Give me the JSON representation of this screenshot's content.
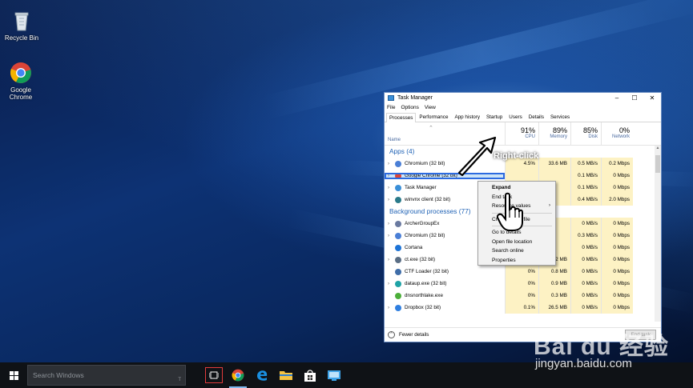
{
  "desktop": {
    "icons": [
      {
        "label": "Recycle Bin",
        "icon": "recycle-bin-icon"
      },
      {
        "label": "Google Chrome",
        "icon": "chrome-icon"
      }
    ]
  },
  "task_manager": {
    "title": "Task Manager",
    "window_controls": [
      "–",
      "☐",
      "✕"
    ],
    "menu": [
      "File",
      "Options",
      "View"
    ],
    "tabs": [
      "Processes",
      "Performance",
      "App history",
      "Startup",
      "Users",
      "Details",
      "Services"
    ],
    "active_tab": "Processes",
    "header": {
      "name": "Name",
      "cpu": {
        "pct": "91%",
        "label": "CPU"
      },
      "memory": {
        "pct": "89%",
        "label": "Memory"
      },
      "disk": {
        "pct": "85%",
        "label": "Disk"
      },
      "network": {
        "pct": "0%",
        "label": "Network"
      }
    },
    "groups": {
      "apps": "Apps (4)",
      "background": "Background processes (77)"
    },
    "apps": [
      {
        "name": "Chromium (32 bit)",
        "cpu": "4.5%",
        "mem": "33.6 MB",
        "disk": "0.5 MB/s",
        "net": "0.2 Mbps",
        "icon": "chromium-icon"
      },
      {
        "name": "Google Chrome (32 bit)",
        "cpu": "",
        "mem": "",
        "disk": "0.1 MB/s",
        "net": "0 Mbps",
        "icon": "chrome-icon"
      },
      {
        "name": "Task Manager",
        "cpu": "",
        "mem": "",
        "disk": "0.1 MB/s",
        "net": "0 Mbps",
        "icon": "task-manager-icon"
      },
      {
        "name": "winvnx client (32 bit)",
        "cpu": "",
        "mem": "",
        "disk": "0.4 MB/s",
        "net": "2.0 Mbps",
        "icon": "window-icon"
      }
    ],
    "background": [
      {
        "name": "ArcherGroupEx",
        "cpu": "",
        "mem": "",
        "disk": "0 MB/s",
        "net": "0 Mbps",
        "icon": "gear-icon"
      },
      {
        "name": "Chromium (32 bit)",
        "cpu": "",
        "mem": "",
        "disk": "0.3 MB/s",
        "net": "0 Mbps",
        "icon": "chromium-icon"
      },
      {
        "name": "Cortana",
        "cpu": "",
        "mem": "",
        "disk": "0 MB/s",
        "net": "0 Mbps",
        "icon": "cortana-icon"
      },
      {
        "name": "ct.exe (32 bit)",
        "cpu": "0%",
        "mem": "1.2 MB",
        "disk": "0 MB/s",
        "net": "0 Mbps",
        "icon": "exe-icon"
      },
      {
        "name": "CTF Loader (32 bit)",
        "cpu": "0%",
        "mem": "0.8 MB",
        "disk": "0 MB/s",
        "net": "0 Mbps",
        "icon": "ctf-icon"
      },
      {
        "name": "dataup.exe (32 bit)",
        "cpu": "0%",
        "mem": "0.9 MB",
        "disk": "0 MB/s",
        "net": "0 Mbps",
        "icon": "dataup-icon"
      },
      {
        "name": "dnsnorthlake.exe",
        "cpu": "0%",
        "mem": "0.3 MB",
        "disk": "0 MB/s",
        "net": "0 Mbps",
        "icon": "leaf-icon"
      },
      {
        "name": "Dropbox (32 bit)",
        "cpu": "0.1%",
        "mem": "26.5 MB",
        "disk": "0 MB/s",
        "net": "0 Mbps",
        "icon": "dropbox-icon"
      }
    ],
    "footer": {
      "fewer_details": "Fewer details",
      "end_task": "End task"
    }
  },
  "context_menu": {
    "items": [
      "Expand",
      "End task",
      "Resource values",
      "Create dump file",
      "Go to details",
      "Open file location",
      "Search online",
      "Properties"
    ]
  },
  "annotation": {
    "label": "Right-click"
  },
  "taskbar": {
    "search_placeholder": "Search Windows",
    "search_mic": "T"
  },
  "watermark": {
    "brand": "Bai du 经验",
    "url": "jingyan.baidu.com"
  },
  "colors": {
    "accent": "#2d6be0",
    "group_blue": "#1f62b5",
    "heat_yellow": "#fdf2c4",
    "highlight_red": "#e23b3b"
  }
}
